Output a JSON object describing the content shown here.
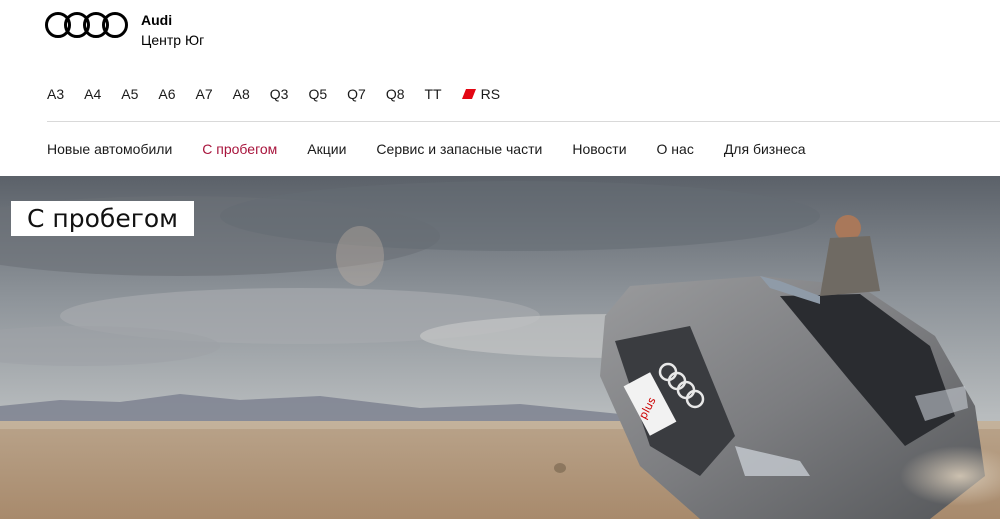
{
  "header": {
    "brand_name": "Audi",
    "dealer_name": "Центр Юг",
    "logo_icon": "audi-rings-icon"
  },
  "models": [
    {
      "label": "A3"
    },
    {
      "label": "A4"
    },
    {
      "label": "A5"
    },
    {
      "label": "A6"
    },
    {
      "label": "A7"
    },
    {
      "label": "A8"
    },
    {
      "label": "Q3"
    },
    {
      "label": "Q5"
    },
    {
      "label": "Q7"
    },
    {
      "label": "Q8"
    },
    {
      "label": "TT"
    },
    {
      "label": "RS"
    }
  ],
  "main_nav": {
    "items": [
      {
        "label": "Новые автомобили"
      },
      {
        "label": "С пробегом"
      },
      {
        "label": "Акции"
      },
      {
        "label": "Сервис и запасные части"
      },
      {
        "label": "Новости"
      },
      {
        "label": "О нас"
      },
      {
        "label": "Для бизнеса"
      }
    ],
    "active_index": 1
  },
  "hero": {
    "title": "С пробегом",
    "plate_text": "plus"
  },
  "colors": {
    "accent": "#a8143c",
    "rs_red": "#e30613",
    "text": "#1a1a1a"
  }
}
